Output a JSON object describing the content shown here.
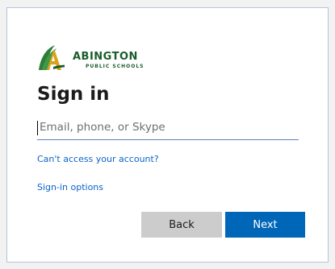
{
  "logo": {
    "name": "ABINGTON",
    "subtitle": "PUBLIC SCHOOLS",
    "icon": "abington-a-logo-icon"
  },
  "signin": {
    "title": "Sign in",
    "email_placeholder": "Email, phone, or Skype",
    "email_value": ""
  },
  "links": {
    "cant_access": "Can't access your account?",
    "signin_options": "Sign-in options"
  },
  "buttons": {
    "back": "Back",
    "next": "Next"
  },
  "colors": {
    "brand_green": "#1a5c2a",
    "link_blue": "#0b63c7",
    "primary_button": "#0067b8",
    "secondary_button": "#cccccc",
    "input_underline": "#5b7fc1"
  }
}
